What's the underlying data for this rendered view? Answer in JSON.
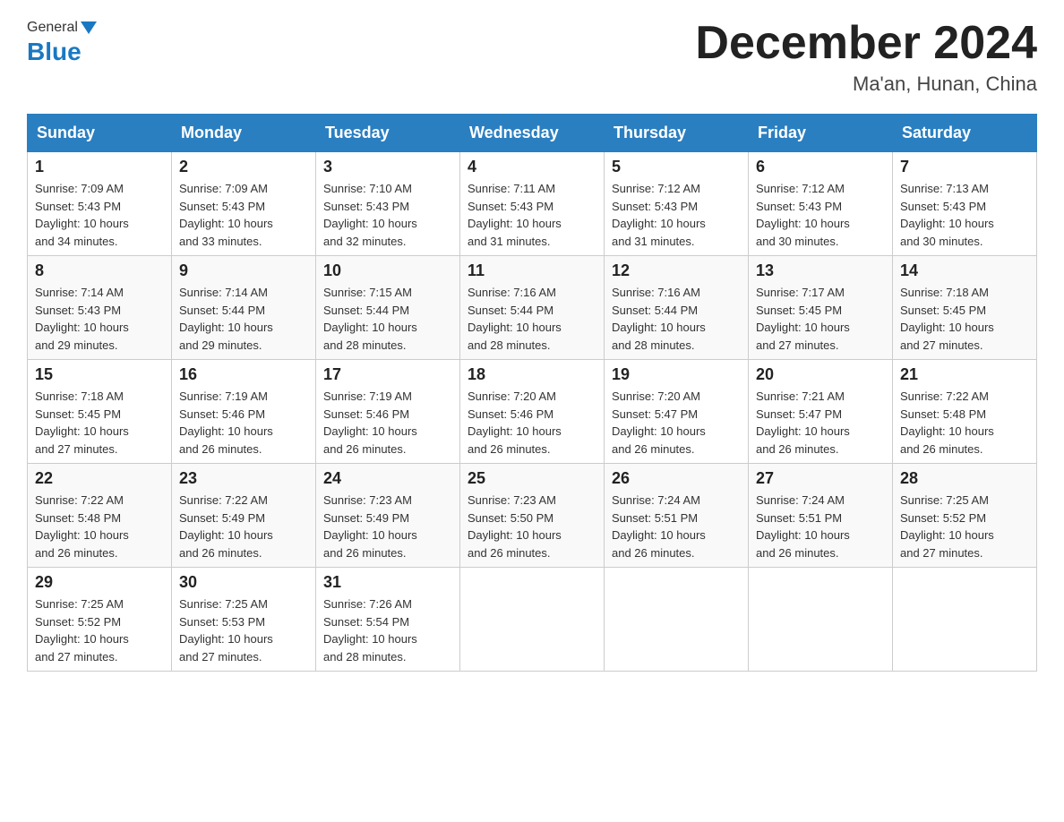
{
  "header": {
    "logo": {
      "general": "General",
      "blue": "Blue"
    },
    "title": "December 2024",
    "location": "Ma'an, Hunan, China"
  },
  "days_of_week": [
    "Sunday",
    "Monday",
    "Tuesday",
    "Wednesday",
    "Thursday",
    "Friday",
    "Saturday"
  ],
  "weeks": [
    [
      {
        "date": "1",
        "sunrise": "7:09 AM",
        "sunset": "5:43 PM",
        "daylight": "10 hours and 34 minutes."
      },
      {
        "date": "2",
        "sunrise": "7:09 AM",
        "sunset": "5:43 PM",
        "daylight": "10 hours and 33 minutes."
      },
      {
        "date": "3",
        "sunrise": "7:10 AM",
        "sunset": "5:43 PM",
        "daylight": "10 hours and 32 minutes."
      },
      {
        "date": "4",
        "sunrise": "7:11 AM",
        "sunset": "5:43 PM",
        "daylight": "10 hours and 31 minutes."
      },
      {
        "date": "5",
        "sunrise": "7:12 AM",
        "sunset": "5:43 PM",
        "daylight": "10 hours and 31 minutes."
      },
      {
        "date": "6",
        "sunrise": "7:12 AM",
        "sunset": "5:43 PM",
        "daylight": "10 hours and 30 minutes."
      },
      {
        "date": "7",
        "sunrise": "7:13 AM",
        "sunset": "5:43 PM",
        "daylight": "10 hours and 30 minutes."
      }
    ],
    [
      {
        "date": "8",
        "sunrise": "7:14 AM",
        "sunset": "5:43 PM",
        "daylight": "10 hours and 29 minutes."
      },
      {
        "date": "9",
        "sunrise": "7:14 AM",
        "sunset": "5:44 PM",
        "daylight": "10 hours and 29 minutes."
      },
      {
        "date": "10",
        "sunrise": "7:15 AM",
        "sunset": "5:44 PM",
        "daylight": "10 hours and 28 minutes."
      },
      {
        "date": "11",
        "sunrise": "7:16 AM",
        "sunset": "5:44 PM",
        "daylight": "10 hours and 28 minutes."
      },
      {
        "date": "12",
        "sunrise": "7:16 AM",
        "sunset": "5:44 PM",
        "daylight": "10 hours and 28 minutes."
      },
      {
        "date": "13",
        "sunrise": "7:17 AM",
        "sunset": "5:45 PM",
        "daylight": "10 hours and 27 minutes."
      },
      {
        "date": "14",
        "sunrise": "7:18 AM",
        "sunset": "5:45 PM",
        "daylight": "10 hours and 27 minutes."
      }
    ],
    [
      {
        "date": "15",
        "sunrise": "7:18 AM",
        "sunset": "5:45 PM",
        "daylight": "10 hours and 27 minutes."
      },
      {
        "date": "16",
        "sunrise": "7:19 AM",
        "sunset": "5:46 PM",
        "daylight": "10 hours and 26 minutes."
      },
      {
        "date": "17",
        "sunrise": "7:19 AM",
        "sunset": "5:46 PM",
        "daylight": "10 hours and 26 minutes."
      },
      {
        "date": "18",
        "sunrise": "7:20 AM",
        "sunset": "5:46 PM",
        "daylight": "10 hours and 26 minutes."
      },
      {
        "date": "19",
        "sunrise": "7:20 AM",
        "sunset": "5:47 PM",
        "daylight": "10 hours and 26 minutes."
      },
      {
        "date": "20",
        "sunrise": "7:21 AM",
        "sunset": "5:47 PM",
        "daylight": "10 hours and 26 minutes."
      },
      {
        "date": "21",
        "sunrise": "7:22 AM",
        "sunset": "5:48 PM",
        "daylight": "10 hours and 26 minutes."
      }
    ],
    [
      {
        "date": "22",
        "sunrise": "7:22 AM",
        "sunset": "5:48 PM",
        "daylight": "10 hours and 26 minutes."
      },
      {
        "date": "23",
        "sunrise": "7:22 AM",
        "sunset": "5:49 PM",
        "daylight": "10 hours and 26 minutes."
      },
      {
        "date": "24",
        "sunrise": "7:23 AM",
        "sunset": "5:49 PM",
        "daylight": "10 hours and 26 minutes."
      },
      {
        "date": "25",
        "sunrise": "7:23 AM",
        "sunset": "5:50 PM",
        "daylight": "10 hours and 26 minutes."
      },
      {
        "date": "26",
        "sunrise": "7:24 AM",
        "sunset": "5:51 PM",
        "daylight": "10 hours and 26 minutes."
      },
      {
        "date": "27",
        "sunrise": "7:24 AM",
        "sunset": "5:51 PM",
        "daylight": "10 hours and 26 minutes."
      },
      {
        "date": "28",
        "sunrise": "7:25 AM",
        "sunset": "5:52 PM",
        "daylight": "10 hours and 27 minutes."
      }
    ],
    [
      {
        "date": "29",
        "sunrise": "7:25 AM",
        "sunset": "5:52 PM",
        "daylight": "10 hours and 27 minutes."
      },
      {
        "date": "30",
        "sunrise": "7:25 AM",
        "sunset": "5:53 PM",
        "daylight": "10 hours and 27 minutes."
      },
      {
        "date": "31",
        "sunrise": "7:26 AM",
        "sunset": "5:54 PM",
        "daylight": "10 hours and 28 minutes."
      },
      null,
      null,
      null,
      null
    ]
  ],
  "labels": {
    "sunrise": "Sunrise:",
    "sunset": "Sunset:",
    "daylight": "Daylight:"
  }
}
